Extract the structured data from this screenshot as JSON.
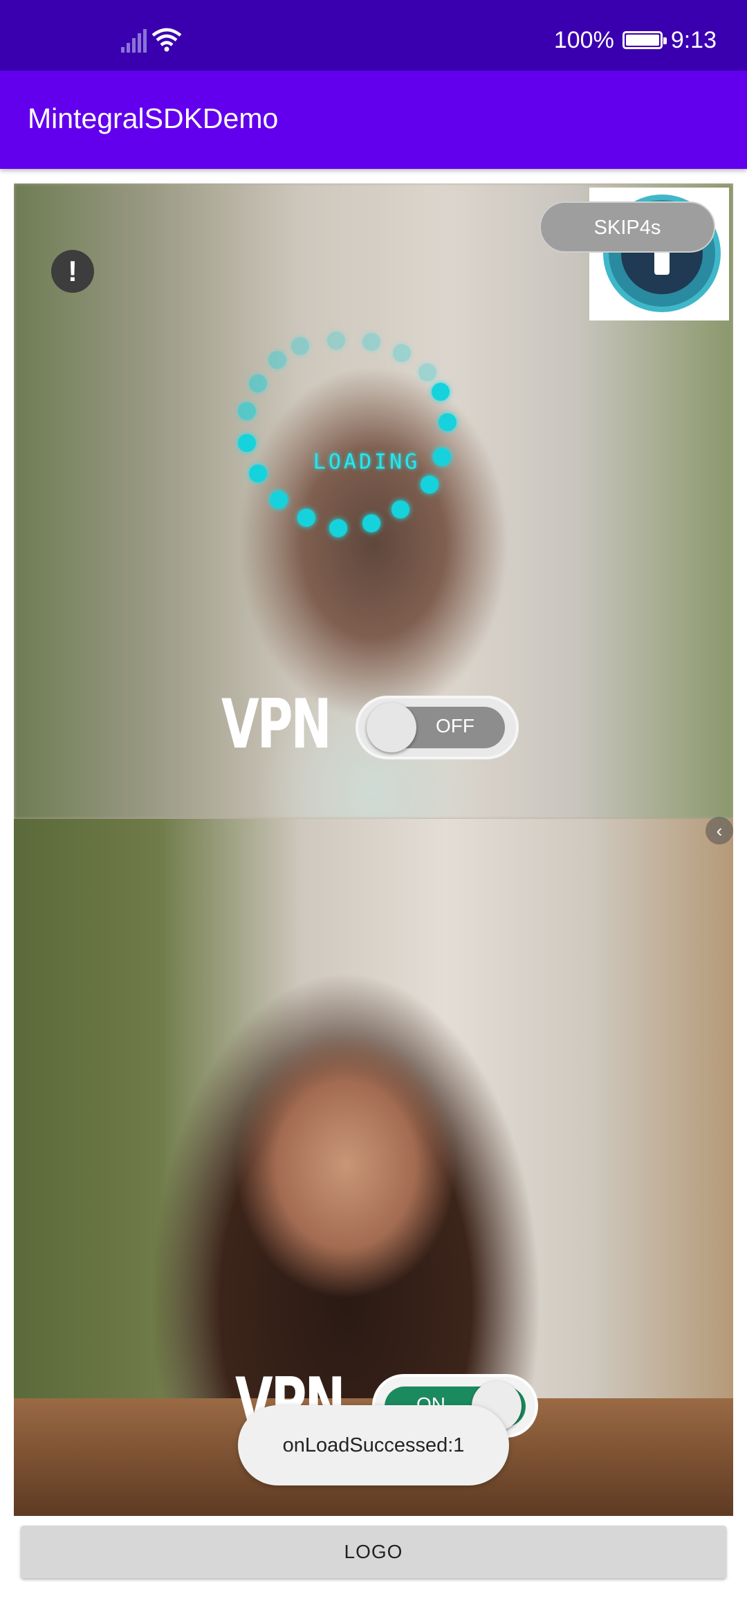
{
  "status_bar": {
    "battery_percent": "100%",
    "time": "9:13",
    "icons": [
      "signal-icon",
      "wifi-icon",
      "battery-icon"
    ]
  },
  "app_bar": {
    "title": "MintegralSDKDemo"
  },
  "ad": {
    "skip_label": "SKIP4s",
    "loading_text": "LOADING",
    "top_panel": {
      "headline": "VPN",
      "toggle_label": "OFF"
    },
    "bottom_panel": {
      "headline": "VPN",
      "toggle_label": "ON"
    },
    "icons": [
      "alert-icon",
      "rocket-logo-icon",
      "chevron-left-icon"
    ]
  },
  "toast": {
    "message": "onLoadSuccessed:1"
  },
  "buttons": {
    "logo_label": "LOGO"
  },
  "colors": {
    "status_bar": "#3a00b0",
    "app_bar": "#6200ee",
    "loader": "#16d2dc",
    "toggle_on": "#1b8a5e"
  }
}
